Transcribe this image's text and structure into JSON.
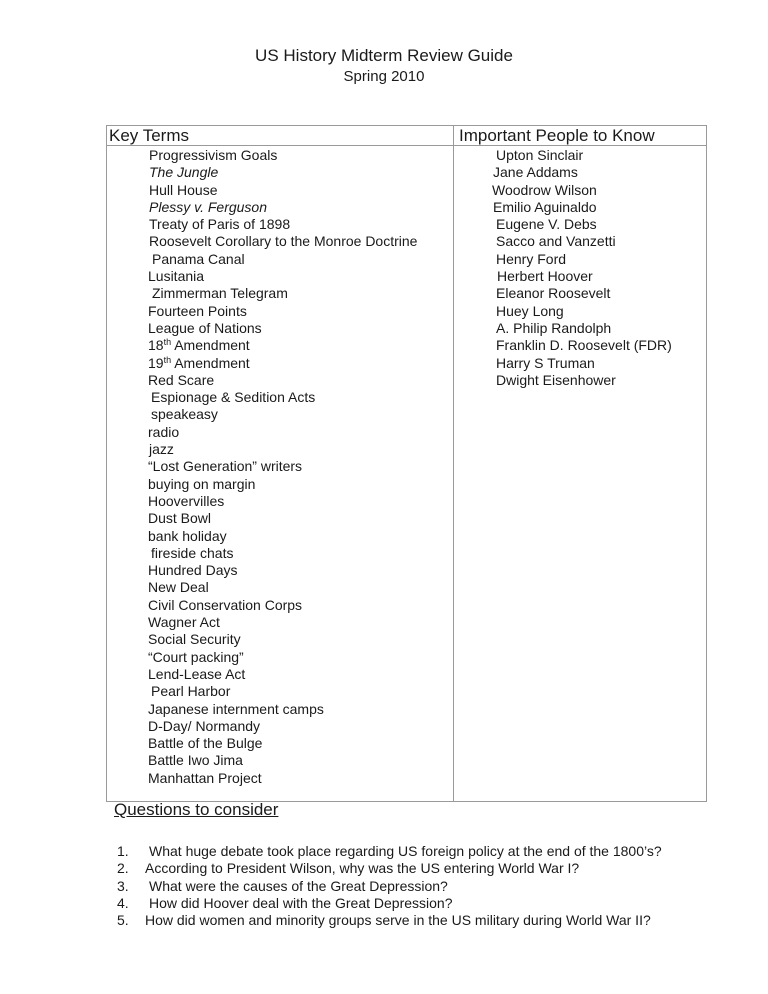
{
  "document": {
    "title": "US History Midterm Review Guide",
    "subtitle": "Spring 2010"
  },
  "table": {
    "key_terms_header": "Key Terms",
    "people_header": "Important People to Know",
    "key_terms": [
      "Progressivism Goals",
      "The Jungle",
      "Hull House",
      "Plessy v. Ferguson",
      "Treaty of Paris of 1898",
      "Roosevelt Corollary to the Monroe Doctrine",
      "Panama Canal",
      "Lusitania",
      "Zimmerman Telegram",
      "Fourteen Points",
      "League of Nations",
      "18",
      "19",
      "Red Scare",
      "Espionage & Sedition Acts",
      "speakeasy",
      "radio",
      "jazz",
      "“Lost Generation” writers",
      "buying on margin",
      "Hoovervilles",
      "Dust Bowl",
      "bank holiday",
      "fireside chats",
      "Hundred Days",
      "New Deal",
      "Civil Conservation Corps",
      "Wagner Act",
      "Social Security",
      "“Court packing”",
      "Lend-Lease Act",
      "Pearl Harbor",
      "Japanese internment camps",
      "D-Day/ Normandy",
      "Battle of the Bulge",
      "Battle Iwo Jima",
      "Manhattan Project"
    ],
    "amendment_suffix": "th",
    "amendment_word": " Amendment",
    "people": [
      "Upton Sinclair",
      "Jane Addams",
      "Woodrow Wilson",
      "Emilio Aguinaldo",
      "Eugene V. Debs",
      "Sacco and Vanzetti",
      "Henry Ford",
      "Herbert Hoover",
      "Eleanor Roosevelt",
      "Huey Long",
      "A.  Philip Randolph",
      "Franklin D. Roosevelt (FDR)",
      "Harry S Truman",
      "Dwight Eisenhower"
    ]
  },
  "questions": {
    "header": "Questions to consider",
    "items": [
      {
        "num": "1.",
        "text": "What huge debate took place regarding US foreign policy at the end of the 1800’s?"
      },
      {
        "num": "2.",
        "text": "According to President Wilson, why was the US entering World War I?"
      },
      {
        "num": "3.",
        "text": "What were the causes of the Great Depression?"
      },
      {
        "num": "4.",
        "text": "How did Hoover deal with the Great Depression?"
      },
      {
        "num": "5.",
        "text": "How did women and minority groups serve in the US military during World War II?"
      }
    ]
  }
}
